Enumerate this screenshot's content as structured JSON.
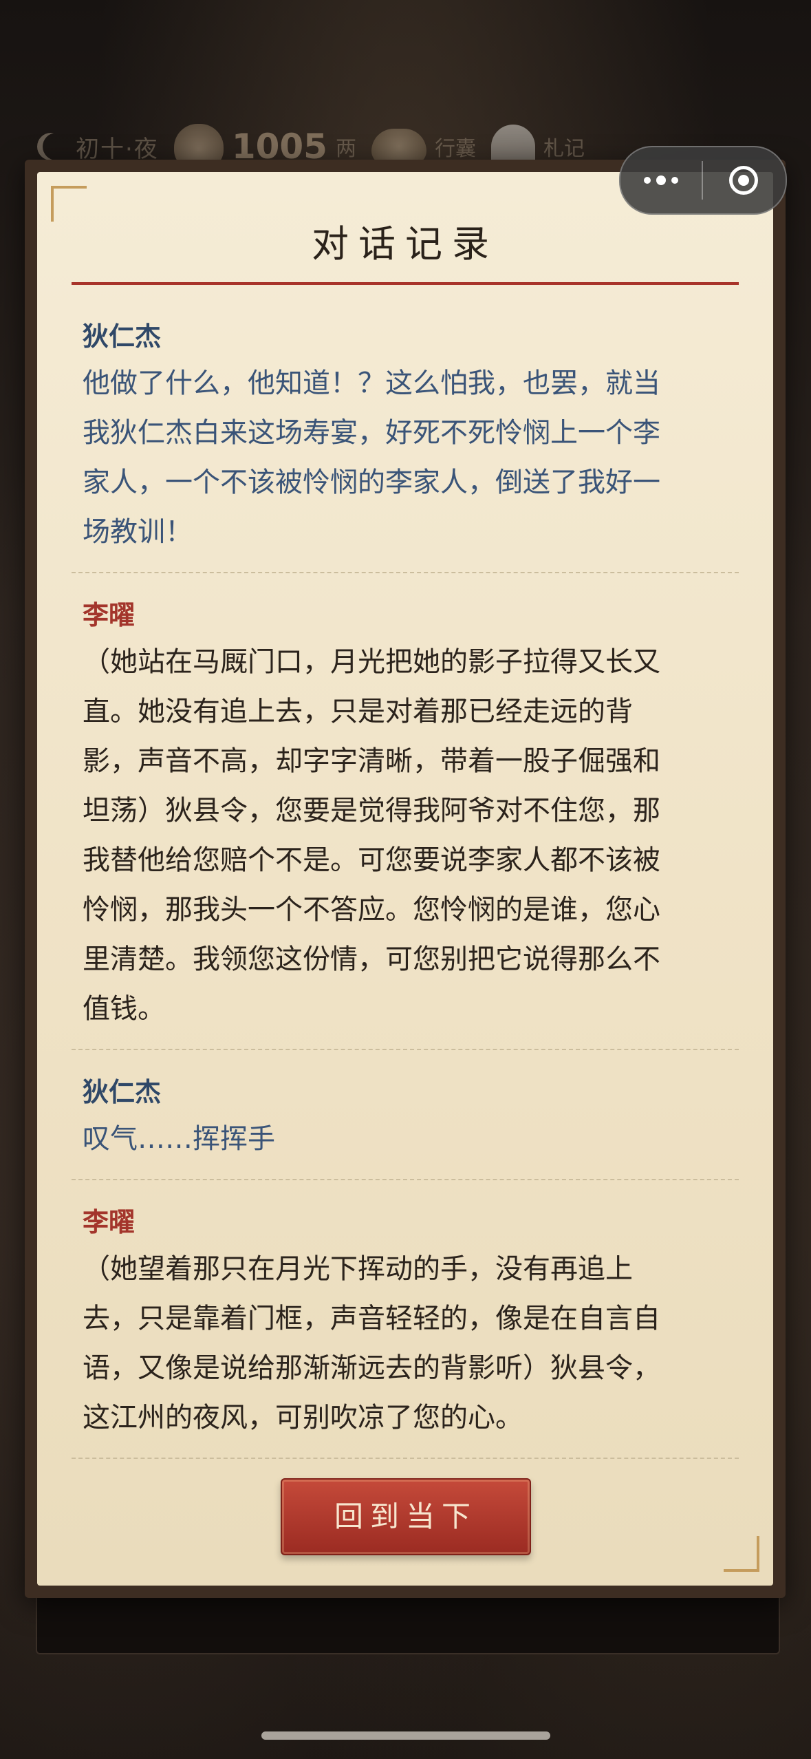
{
  "status": {
    "day": "初十·夜",
    "coins": "1005",
    "coin_unit": "两",
    "bag_label": "行囊",
    "notes_label": "札记"
  },
  "dialog": {
    "title": "对话记录",
    "entries": [
      {
        "speaker": "狄仁杰",
        "lines": [
          "他做了什么，他知道！？这么怕我，也罢，就当",
          "我狄仁杰白来这场寿宴，好死不死怜悯上一个李",
          "家人，一个不该被怜悯的李家人，倒送了我好一",
          "场教训！"
        ]
      },
      {
        "speaker": "李曜",
        "lines": [
          "（她站在马厩门口，月光把她的影子拉得又长又",
          "直。她没有追上去，只是对着那已经走远的背",
          "影，声音不高，却字字清晰，带着一股子倔强和",
          "坦荡）狄县令，您要是觉得我阿爷对不住您，那",
          "我替他给您赔个不是。可您要说李家人都不该被",
          "怜悯，那我头一个不答应。您怜悯的是谁，您心",
          "里清楚。我领您这份情，可您别把它说得那么不",
          "值钱。"
        ]
      },
      {
        "speaker": "狄仁杰",
        "lines": [
          "叹气……挥挥手"
        ]
      },
      {
        "speaker": "李曜",
        "lines": [
          "（她望着那只在月光下挥动的手，没有再追上",
          "去，只是靠着门框，声音轻轻的，像是在自言自",
          "语，又像是说给那渐渐远去的背影听）狄县令，",
          "这江州的夜风，可别吹凉了您的心。"
        ]
      }
    ],
    "button": "回到当下"
  },
  "colors": {
    "accent_red": "#a8342a",
    "speaker_blue": "#2f4868",
    "parchment": "#f2e6cb"
  }
}
